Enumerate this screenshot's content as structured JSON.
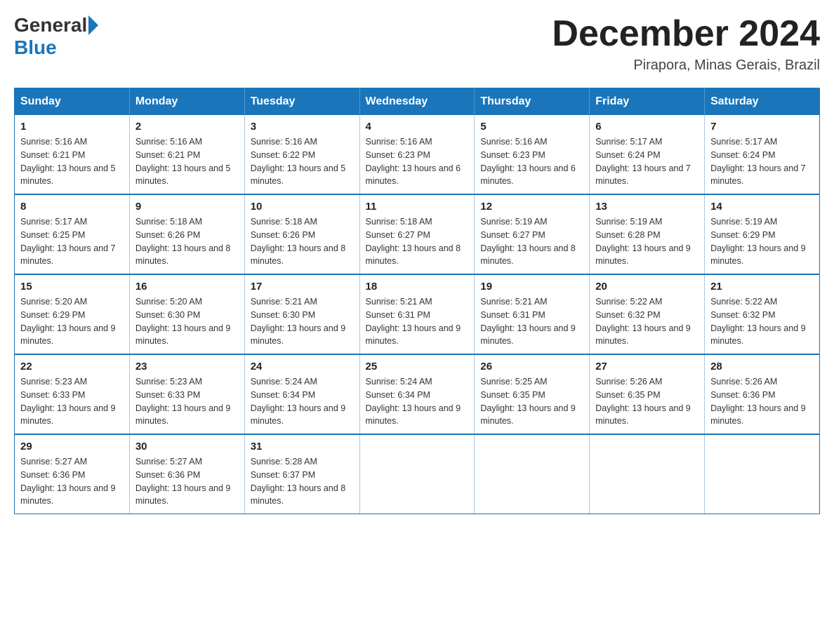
{
  "logo": {
    "general": "General",
    "blue": "Blue"
  },
  "title": {
    "month": "December 2024",
    "location": "Pirapora, Minas Gerais, Brazil"
  },
  "days_of_week": [
    "Sunday",
    "Monday",
    "Tuesday",
    "Wednesday",
    "Thursday",
    "Friday",
    "Saturday"
  ],
  "weeks": [
    [
      {
        "day": "1",
        "sunrise": "5:16 AM",
        "sunset": "6:21 PM",
        "daylight": "13 hours and 5 minutes."
      },
      {
        "day": "2",
        "sunrise": "5:16 AM",
        "sunset": "6:21 PM",
        "daylight": "13 hours and 5 minutes."
      },
      {
        "day": "3",
        "sunrise": "5:16 AM",
        "sunset": "6:22 PM",
        "daylight": "13 hours and 5 minutes."
      },
      {
        "day": "4",
        "sunrise": "5:16 AM",
        "sunset": "6:23 PM",
        "daylight": "13 hours and 6 minutes."
      },
      {
        "day": "5",
        "sunrise": "5:16 AM",
        "sunset": "6:23 PM",
        "daylight": "13 hours and 6 minutes."
      },
      {
        "day": "6",
        "sunrise": "5:17 AM",
        "sunset": "6:24 PM",
        "daylight": "13 hours and 7 minutes."
      },
      {
        "day": "7",
        "sunrise": "5:17 AM",
        "sunset": "6:24 PM",
        "daylight": "13 hours and 7 minutes."
      }
    ],
    [
      {
        "day": "8",
        "sunrise": "5:17 AM",
        "sunset": "6:25 PM",
        "daylight": "13 hours and 7 minutes."
      },
      {
        "day": "9",
        "sunrise": "5:18 AM",
        "sunset": "6:26 PM",
        "daylight": "13 hours and 8 minutes."
      },
      {
        "day": "10",
        "sunrise": "5:18 AM",
        "sunset": "6:26 PM",
        "daylight": "13 hours and 8 minutes."
      },
      {
        "day": "11",
        "sunrise": "5:18 AM",
        "sunset": "6:27 PM",
        "daylight": "13 hours and 8 minutes."
      },
      {
        "day": "12",
        "sunrise": "5:19 AM",
        "sunset": "6:27 PM",
        "daylight": "13 hours and 8 minutes."
      },
      {
        "day": "13",
        "sunrise": "5:19 AM",
        "sunset": "6:28 PM",
        "daylight": "13 hours and 9 minutes."
      },
      {
        "day": "14",
        "sunrise": "5:19 AM",
        "sunset": "6:29 PM",
        "daylight": "13 hours and 9 minutes."
      }
    ],
    [
      {
        "day": "15",
        "sunrise": "5:20 AM",
        "sunset": "6:29 PM",
        "daylight": "13 hours and 9 minutes."
      },
      {
        "day": "16",
        "sunrise": "5:20 AM",
        "sunset": "6:30 PM",
        "daylight": "13 hours and 9 minutes."
      },
      {
        "day": "17",
        "sunrise": "5:21 AM",
        "sunset": "6:30 PM",
        "daylight": "13 hours and 9 minutes."
      },
      {
        "day": "18",
        "sunrise": "5:21 AM",
        "sunset": "6:31 PM",
        "daylight": "13 hours and 9 minutes."
      },
      {
        "day": "19",
        "sunrise": "5:21 AM",
        "sunset": "6:31 PM",
        "daylight": "13 hours and 9 minutes."
      },
      {
        "day": "20",
        "sunrise": "5:22 AM",
        "sunset": "6:32 PM",
        "daylight": "13 hours and 9 minutes."
      },
      {
        "day": "21",
        "sunrise": "5:22 AM",
        "sunset": "6:32 PM",
        "daylight": "13 hours and 9 minutes."
      }
    ],
    [
      {
        "day": "22",
        "sunrise": "5:23 AM",
        "sunset": "6:33 PM",
        "daylight": "13 hours and 9 minutes."
      },
      {
        "day": "23",
        "sunrise": "5:23 AM",
        "sunset": "6:33 PM",
        "daylight": "13 hours and 9 minutes."
      },
      {
        "day": "24",
        "sunrise": "5:24 AM",
        "sunset": "6:34 PM",
        "daylight": "13 hours and 9 minutes."
      },
      {
        "day": "25",
        "sunrise": "5:24 AM",
        "sunset": "6:34 PM",
        "daylight": "13 hours and 9 minutes."
      },
      {
        "day": "26",
        "sunrise": "5:25 AM",
        "sunset": "6:35 PM",
        "daylight": "13 hours and 9 minutes."
      },
      {
        "day": "27",
        "sunrise": "5:26 AM",
        "sunset": "6:35 PM",
        "daylight": "13 hours and 9 minutes."
      },
      {
        "day": "28",
        "sunrise": "5:26 AM",
        "sunset": "6:36 PM",
        "daylight": "13 hours and 9 minutes."
      }
    ],
    [
      {
        "day": "29",
        "sunrise": "5:27 AM",
        "sunset": "6:36 PM",
        "daylight": "13 hours and 9 minutes."
      },
      {
        "day": "30",
        "sunrise": "5:27 AM",
        "sunset": "6:36 PM",
        "daylight": "13 hours and 9 minutes."
      },
      {
        "day": "31",
        "sunrise": "5:28 AM",
        "sunset": "6:37 PM",
        "daylight": "13 hours and 8 minutes."
      },
      null,
      null,
      null,
      null
    ]
  ]
}
